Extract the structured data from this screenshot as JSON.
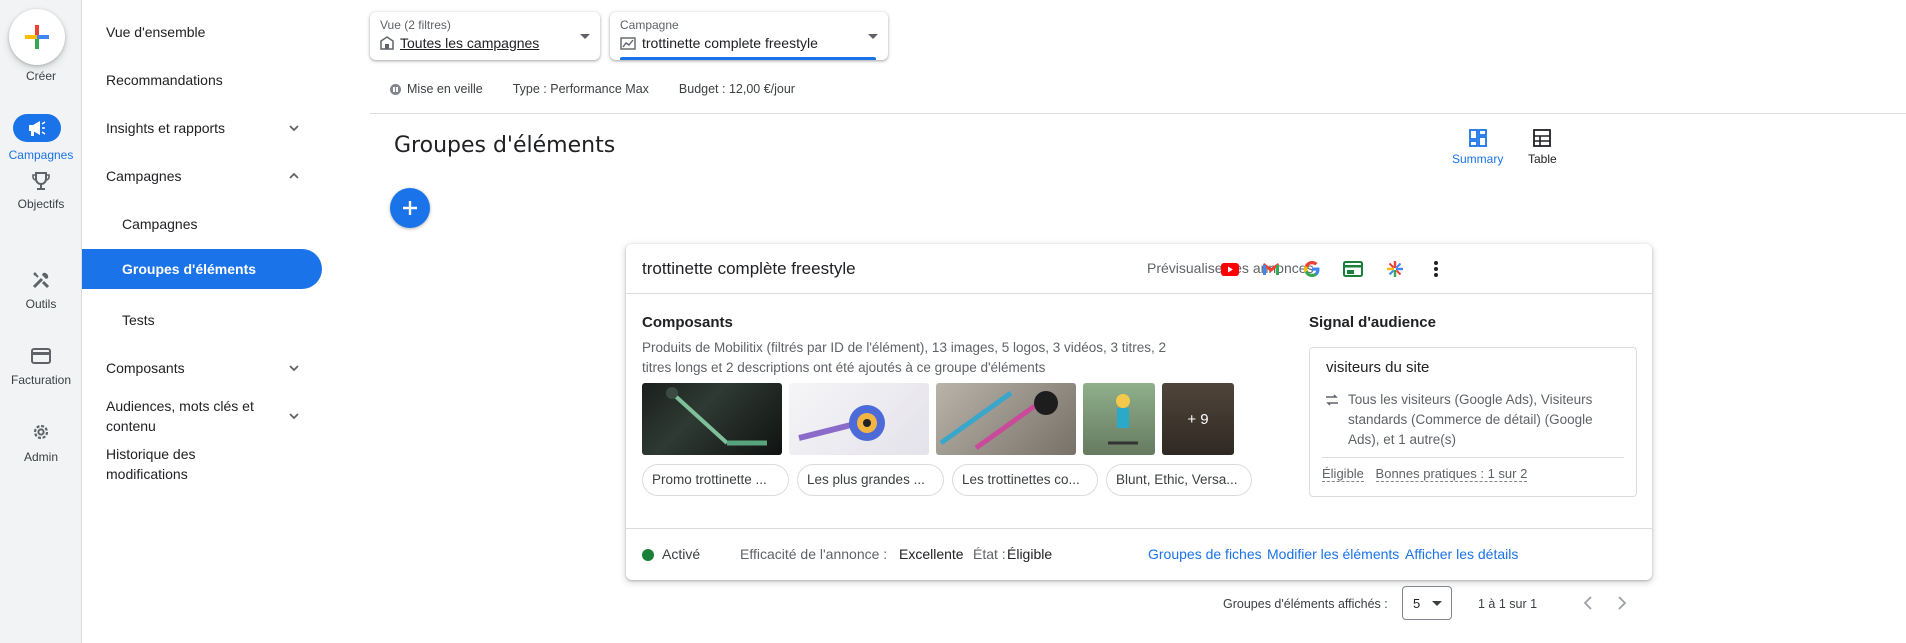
{
  "rail": {
    "items": [
      {
        "label": "Créer",
        "icon": "plus-icon"
      },
      {
        "label": "Campagnes",
        "icon": "campaign-icon",
        "active": true
      },
      {
        "label": "Objectifs",
        "icon": "trophy-icon"
      },
      {
        "label": "Outils",
        "icon": "tools-icon"
      },
      {
        "label": "Facturation",
        "icon": "credit-card-icon"
      },
      {
        "label": "Admin",
        "icon": "gear-icon"
      }
    ]
  },
  "nav": {
    "items": [
      {
        "label": "Vue d'ensemble"
      },
      {
        "label": "Recommandations"
      },
      {
        "label": "Insights et rapports"
      },
      {
        "label": "Campagnes"
      },
      {
        "label": "Campagnes"
      },
      {
        "label": "Groupes d'éléments"
      },
      {
        "label": "Tests"
      },
      {
        "label": "Composants"
      },
      {
        "label": "Audiences, mots clés et contenu"
      },
      {
        "label": "Historique des modifications"
      }
    ]
  },
  "header": {
    "view_label": "Vue (2 filtres)",
    "view_value": "Toutes les campagnes",
    "campaign_label": "Campagne",
    "campaign_value": "trottinette complete freestyle",
    "status": "Mise en veille",
    "type": "Type : Performance Max",
    "budget": "Budget : 12,00 €/jour"
  },
  "page": {
    "title": "Groupes d'éléments",
    "view_summary": "Summary",
    "view_table": "Table"
  },
  "card": {
    "title": "trottinette complète freestyle",
    "preview_label": "Prévisualiser les annonces",
    "components_title": "Composants",
    "components_desc": "Produits de Mobilitix (filtrés par ID de l'élément), 13 images, 5 logos, 3 vidéos, 3 titres, 2 titres longs et 2 descriptions ont été ajoutés à ce groupe d'éléments",
    "more_images": "+ 9",
    "text_assets": [
      "Promo trottinette ...",
      "Les plus grandes ...",
      "Les trottinettes co...",
      "Blunt, Ethic, Versa..."
    ],
    "audience_title": "Signal d'audience",
    "audience_name": "visiteurs du site",
    "audience_desc": "Tous les visiteurs (Google Ads), Visiteurs standards (Commerce de détail) (Google Ads), et 1 autre(s)",
    "audience_eligible": "Éligible",
    "audience_best": "Bonnes pratiques : 1 sur 2",
    "status": "Activé",
    "efficacy_label": "Efficacité de l'annonce :",
    "efficacy_value": "Excellente",
    "state_label": "État :",
    "state_value": "Éligible",
    "link_listing": "Groupes de fiches",
    "link_edit": "Modifier les éléments",
    "link_details": "Afficher les détails"
  },
  "pager": {
    "label": "Groupes d'éléments affichés :",
    "size": "5",
    "range": "1 à 1 sur 1"
  },
  "colors": {
    "accent": "#1a73e8",
    "active_green": "#188038"
  }
}
